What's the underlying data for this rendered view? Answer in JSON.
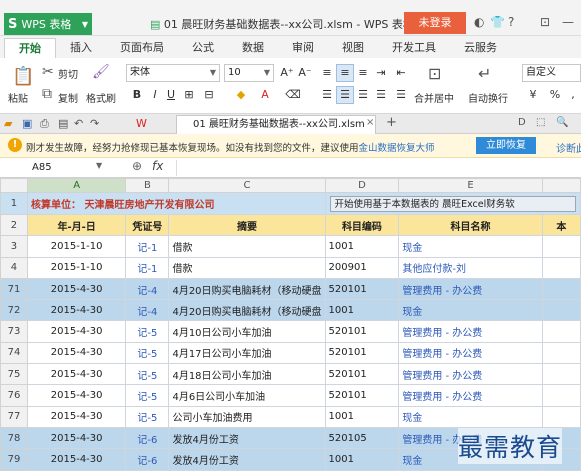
{
  "titlebar": {
    "app_label": "WPS 表格",
    "doc_title": "01 晨旺财务基础数据表--xx公司.xlsm - WPS 表格",
    "login_label": "未登录"
  },
  "ribbon_tabs": [
    "开始",
    "插入",
    "页面布局",
    "公式",
    "数据",
    "审阅",
    "视图",
    "开发工具",
    "云服务"
  ],
  "ribbon": {
    "cut": "剪切",
    "paste": "粘贴",
    "copy": "复制",
    "format_painter": "格式刷",
    "font_name": "宋体",
    "font_size": "10",
    "merge_center": "合并居中",
    "wrap_text": "自动换行",
    "number_format": "自定义"
  },
  "doc_tab": "01 晨旺财务基础数据表--xx公司.xlsm",
  "notice": {
    "text": "刚才发生故障，经努力抢修现已基本恢复现场。如没有找到您的文件，建议使用",
    "link": "金山数据恢复大师",
    "button": "立即恢复",
    "diag": "诊断此"
  },
  "formula_bar": {
    "cell_ref": "A85",
    "fx": "fx"
  },
  "columns": [
    "A",
    "B",
    "C",
    "D",
    "E",
    ""
  ],
  "banner": {
    "row": "1",
    "company": "核算单位：  天津晨旺房地产开发有限公司",
    "start_button": "开始使用基于本数据表的 晨旺Excel财务软"
  },
  "header": {
    "row": "2",
    "cells": [
      "年-月-日",
      "凭证号",
      "摘要",
      "科目编码",
      "科目名称",
      "本"
    ]
  },
  "rows": [
    {
      "row": "3",
      "date": "2015-1-10",
      "voucher": "记-1",
      "summary": "借款",
      "code": "1001",
      "name": "现金",
      "hl": false
    },
    {
      "row": "4",
      "date": "2015-1-10",
      "voucher": "记-1",
      "summary": "借款",
      "code": "200901",
      "name": "其他应付款-刘",
      "hl": false
    },
    {
      "row": "71",
      "date": "2015-4-30",
      "voucher": "记-4",
      "summary": "4月20日购买电脑耗材（移动硬盘",
      "code": "520101",
      "name": "管理费用 - 办公费",
      "hl": true
    },
    {
      "row": "72",
      "date": "2015-4-30",
      "voucher": "记-4",
      "summary": "4月20日购买电脑耗材（移动硬盘",
      "code": "1001",
      "name": "现金",
      "hl": true
    },
    {
      "row": "73",
      "date": "2015-4-30",
      "voucher": "记-5",
      "summary": "4月10日公司小车加油",
      "code": "520101",
      "name": "管理费用 - 办公费",
      "hl": false
    },
    {
      "row": "74",
      "date": "2015-4-30",
      "voucher": "记-5",
      "summary": "4月17日公司小车加油",
      "code": "520101",
      "name": "管理费用 - 办公费",
      "hl": false
    },
    {
      "row": "75",
      "date": "2015-4-30",
      "voucher": "记-5",
      "summary": "4月18日公司小车加油",
      "code": "520101",
      "name": "管理费用 - 办公费",
      "hl": false
    },
    {
      "row": "76",
      "date": "2015-4-30",
      "voucher": "记-5",
      "summary": "4月6日公司小车加油",
      "code": "520101",
      "name": "管理费用 - 办公费",
      "hl": false
    },
    {
      "row": "77",
      "date": "2015-4-30",
      "voucher": "记-5",
      "summary": "公司小车加油费用",
      "code": "1001",
      "name": "现金",
      "hl": false
    },
    {
      "row": "78",
      "date": "2015-4-30",
      "voucher": "记-6",
      "summary": "发放4月份工资",
      "code": "520105",
      "name": "管理费用 - 办公费",
      "hl": true
    },
    {
      "row": "79",
      "date": "2015-4-30",
      "voucher": "记-6",
      "summary": "发放4月份工资",
      "code": "1001",
      "name": "现金",
      "hl": true
    }
  ],
  "watermark": "最需教育"
}
